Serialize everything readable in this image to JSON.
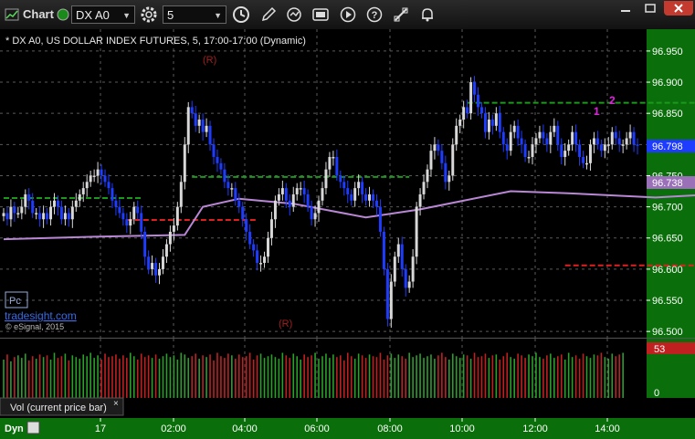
{
  "toolbar": {
    "title": "Chart",
    "symbol": "DX A0",
    "interval": "5"
  },
  "chart_header": "* DX A0, US DOLLAR INDEX FUTURES, 5, 17:00-17:00 (Dynamic)",
  "watermark": {
    "badge": "Pc",
    "site": "tradesight.com",
    "copyright": "© eSignal, 2015"
  },
  "price_axis": {
    "ticks": [
      "96.950",
      "96.900",
      "96.850",
      "96.800",
      "96.750",
      "96.700",
      "96.650",
      "96.600",
      "96.550",
      "96.500"
    ],
    "last_price": "96.798",
    "ma_price": "96.738"
  },
  "volume_axis": {
    "current": "53",
    "zero": "0"
  },
  "volume_label": "Vol (current price bar)",
  "time_axis": {
    "mode": "Dyn",
    "ticks": [
      "17",
      "02:00",
      "04:00",
      "06:00",
      "08:00",
      "10:00",
      "12:00",
      "14:00"
    ]
  },
  "annotations": {
    "r_top": "(R)",
    "r_bottom": "(R)",
    "one": "1",
    "two": "2"
  },
  "colors": {
    "up": "#d8d8d8",
    "down": "#1e3cff",
    "ma": "#b987d6",
    "resistance": "#1a9a1a",
    "support": "#e02020",
    "volume_up": "#2aa02a",
    "volume_down": "#c02020",
    "sidebar": "#0a7a0a"
  },
  "chart_data": {
    "type": "candlestick",
    "title": "* DX A0, US DOLLAR INDEX FUTURES, 5, 17:00-17:00 (Dynamic)",
    "x_ticks": [
      "17",
      "02:00",
      "04:00",
      "06:00",
      "08:00",
      "10:00",
      "12:00",
      "14:00"
    ],
    "ylim": [
      96.49,
      96.985
    ],
    "y_ticks": [
      96.95,
      96.9,
      96.85,
      96.8,
      96.75,
      96.7,
      96.65,
      96.6,
      96.55,
      96.5
    ],
    "last_price": 96.798,
    "moving_average_last": 96.738,
    "close": [
      96.69,
      96.68,
      96.7,
      96.69,
      96.69,
      96.7,
      96.72,
      96.71,
      96.69,
      96.69,
      96.68,
      96.69,
      96.68,
      96.7,
      96.71,
      96.7,
      96.68,
      96.69,
      96.68,
      96.7,
      96.71,
      96.72,
      96.73,
      96.74,
      96.75,
      96.75,
      96.76,
      96.75,
      96.74,
      96.73,
      96.71,
      96.7,
      96.69,
      96.68,
      96.67,
      96.68,
      96.7,
      96.69,
      96.66,
      96.62,
      96.6,
      96.61,
      96.59,
      96.6,
      96.62,
      96.64,
      96.66,
      96.67,
      96.7,
      96.74,
      96.8,
      96.86,
      96.85,
      96.83,
      96.84,
      96.82,
      96.83,
      96.8,
      96.78,
      96.77,
      96.76,
      96.74,
      96.73,
      96.73,
      96.71,
      96.7,
      96.68,
      96.66,
      96.64,
      96.63,
      96.61,
      96.61,
      96.62,
      96.65,
      96.68,
      96.71,
      96.72,
      96.73,
      96.71,
      96.7,
      96.72,
      96.73,
      96.73,
      96.72,
      96.7,
      96.68,
      96.69,
      96.71,
      96.73,
      96.76,
      96.78,
      96.78,
      96.75,
      96.74,
      96.73,
      96.72,
      96.71,
      96.73,
      96.74,
      96.72,
      96.71,
      96.72,
      96.71,
      96.7,
      96.66,
      96.6,
      96.52,
      96.58,
      96.62,
      96.64,
      96.6,
      96.57,
      96.58,
      96.62,
      96.7,
      96.72,
      96.74,
      96.76,
      96.79,
      96.8,
      96.79,
      96.77,
      96.74,
      96.75,
      96.8,
      96.83,
      96.84,
      96.86,
      96.85,
      96.9,
      96.88,
      96.86,
      96.85,
      96.82,
      96.84,
      96.83,
      96.85,
      96.82,
      96.8,
      96.79,
      96.82,
      96.83,
      96.81,
      96.8,
      96.78,
      96.78,
      96.8,
      96.81,
      96.82,
      96.81,
      96.8,
      96.82,
      96.83,
      96.8,
      96.78,
      96.79,
      96.8,
      96.82,
      96.8,
      96.78,
      96.77,
      96.77,
      96.8,
      96.81,
      96.8,
      96.79,
      96.8,
      96.8,
      96.82,
      96.81,
      96.8,
      96.8,
      96.81,
      96.82,
      96.8,
      96.798
    ],
    "moving_average": [
      {
        "x": 0,
        "y": 96.648
      },
      {
        "x": 25,
        "y": 96.652
      },
      {
        "x": 50,
        "y": 96.655
      },
      {
        "x": 55,
        "y": 96.7
      },
      {
        "x": 65,
        "y": 96.713
      },
      {
        "x": 80,
        "y": 96.705
      },
      {
        "x": 100,
        "y": 96.683
      },
      {
        "x": 115,
        "y": 96.696
      },
      {
        "x": 140,
        "y": 96.725
      },
      {
        "x": 155,
        "y": 96.722
      },
      {
        "x": 180,
        "y": 96.715
      },
      {
        "x": 205,
        "y": 96.723
      },
      {
        "x": 230,
        "y": 96.718
      },
      {
        "x": 250,
        "y": 96.715
      },
      {
        "x": 275,
        "y": 96.727
      },
      {
        "x": 310,
        "y": 96.733
      },
      {
        "x": 344,
        "y": 96.738
      }
    ],
    "levels": [
      {
        "type": "resistance",
        "from_x": 0,
        "to_x": 38,
        "y": 96.714
      },
      {
        "type": "resistance",
        "from_x": 52,
        "to_x": 112,
        "y": 96.748
      },
      {
        "type": "resistance",
        "from_x": 128,
        "to_x": 272,
        "y": 96.867
      },
      {
        "type": "support",
        "from_x": 34,
        "to_x": 70,
        "y": 96.679
      },
      {
        "type": "support",
        "from_x": 155,
        "to_x": 222,
        "y": 96.606
      },
      {
        "type": "support",
        "from_x": 330,
        "to_x": 344,
        "y": 96.775
      }
    ],
    "volume": [
      45,
      51,
      43,
      48,
      50,
      47,
      52,
      44,
      49,
      46,
      51,
      48,
      50,
      45,
      53,
      47,
      49,
      52,
      44,
      50,
      48,
      46,
      51,
      49,
      53,
      47,
      50,
      45,
      52,
      48,
      49,
      51,
      46,
      50,
      47,
      53,
      49,
      45,
      52,
      48,
      50,
      47,
      51,
      46,
      49,
      52,
      48,
      50,
      45,
      53,
      51,
      47,
      49,
      52,
      46,
      50,
      48,
      51,
      44,
      53,
      49,
      47,
      52,
      50,
      46,
      51,
      48,
      49,
      53,
      45,
      50,
      52,
      47,
      49,
      51,
      48,
      46,
      53,
      50,
      47,
      52,
      49,
      45,
      51,
      48,
      50,
      53,
      46,
      49,
      52,
      47,
      51,
      48,
      50,
      44,
      53,
      49,
      46,
      52,
      50,
      47,
      51,
      49,
      48,
      53,
      45,
      50,
      52,
      47,
      51,
      49,
      46,
      53,
      48,
      50,
      52,
      47,
      49,
      51,
      46,
      50,
      53,
      48,
      45,
      52,
      49,
      47,
      51,
      50,
      46,
      53,
      48,
      49,
      52,
      47,
      50,
      51,
      45,
      49,
      53,
      48,
      46,
      52,
      50,
      47,
      51,
      49,
      53,
      48,
      46,
      50,
      52,
      47,
      49,
      51,
      45,
      53,
      48,
      50,
      46,
      52,
      49,
      47,
      51,
      50,
      53,
      48,
      46,
      52,
      49,
      51,
      53
    ]
  }
}
